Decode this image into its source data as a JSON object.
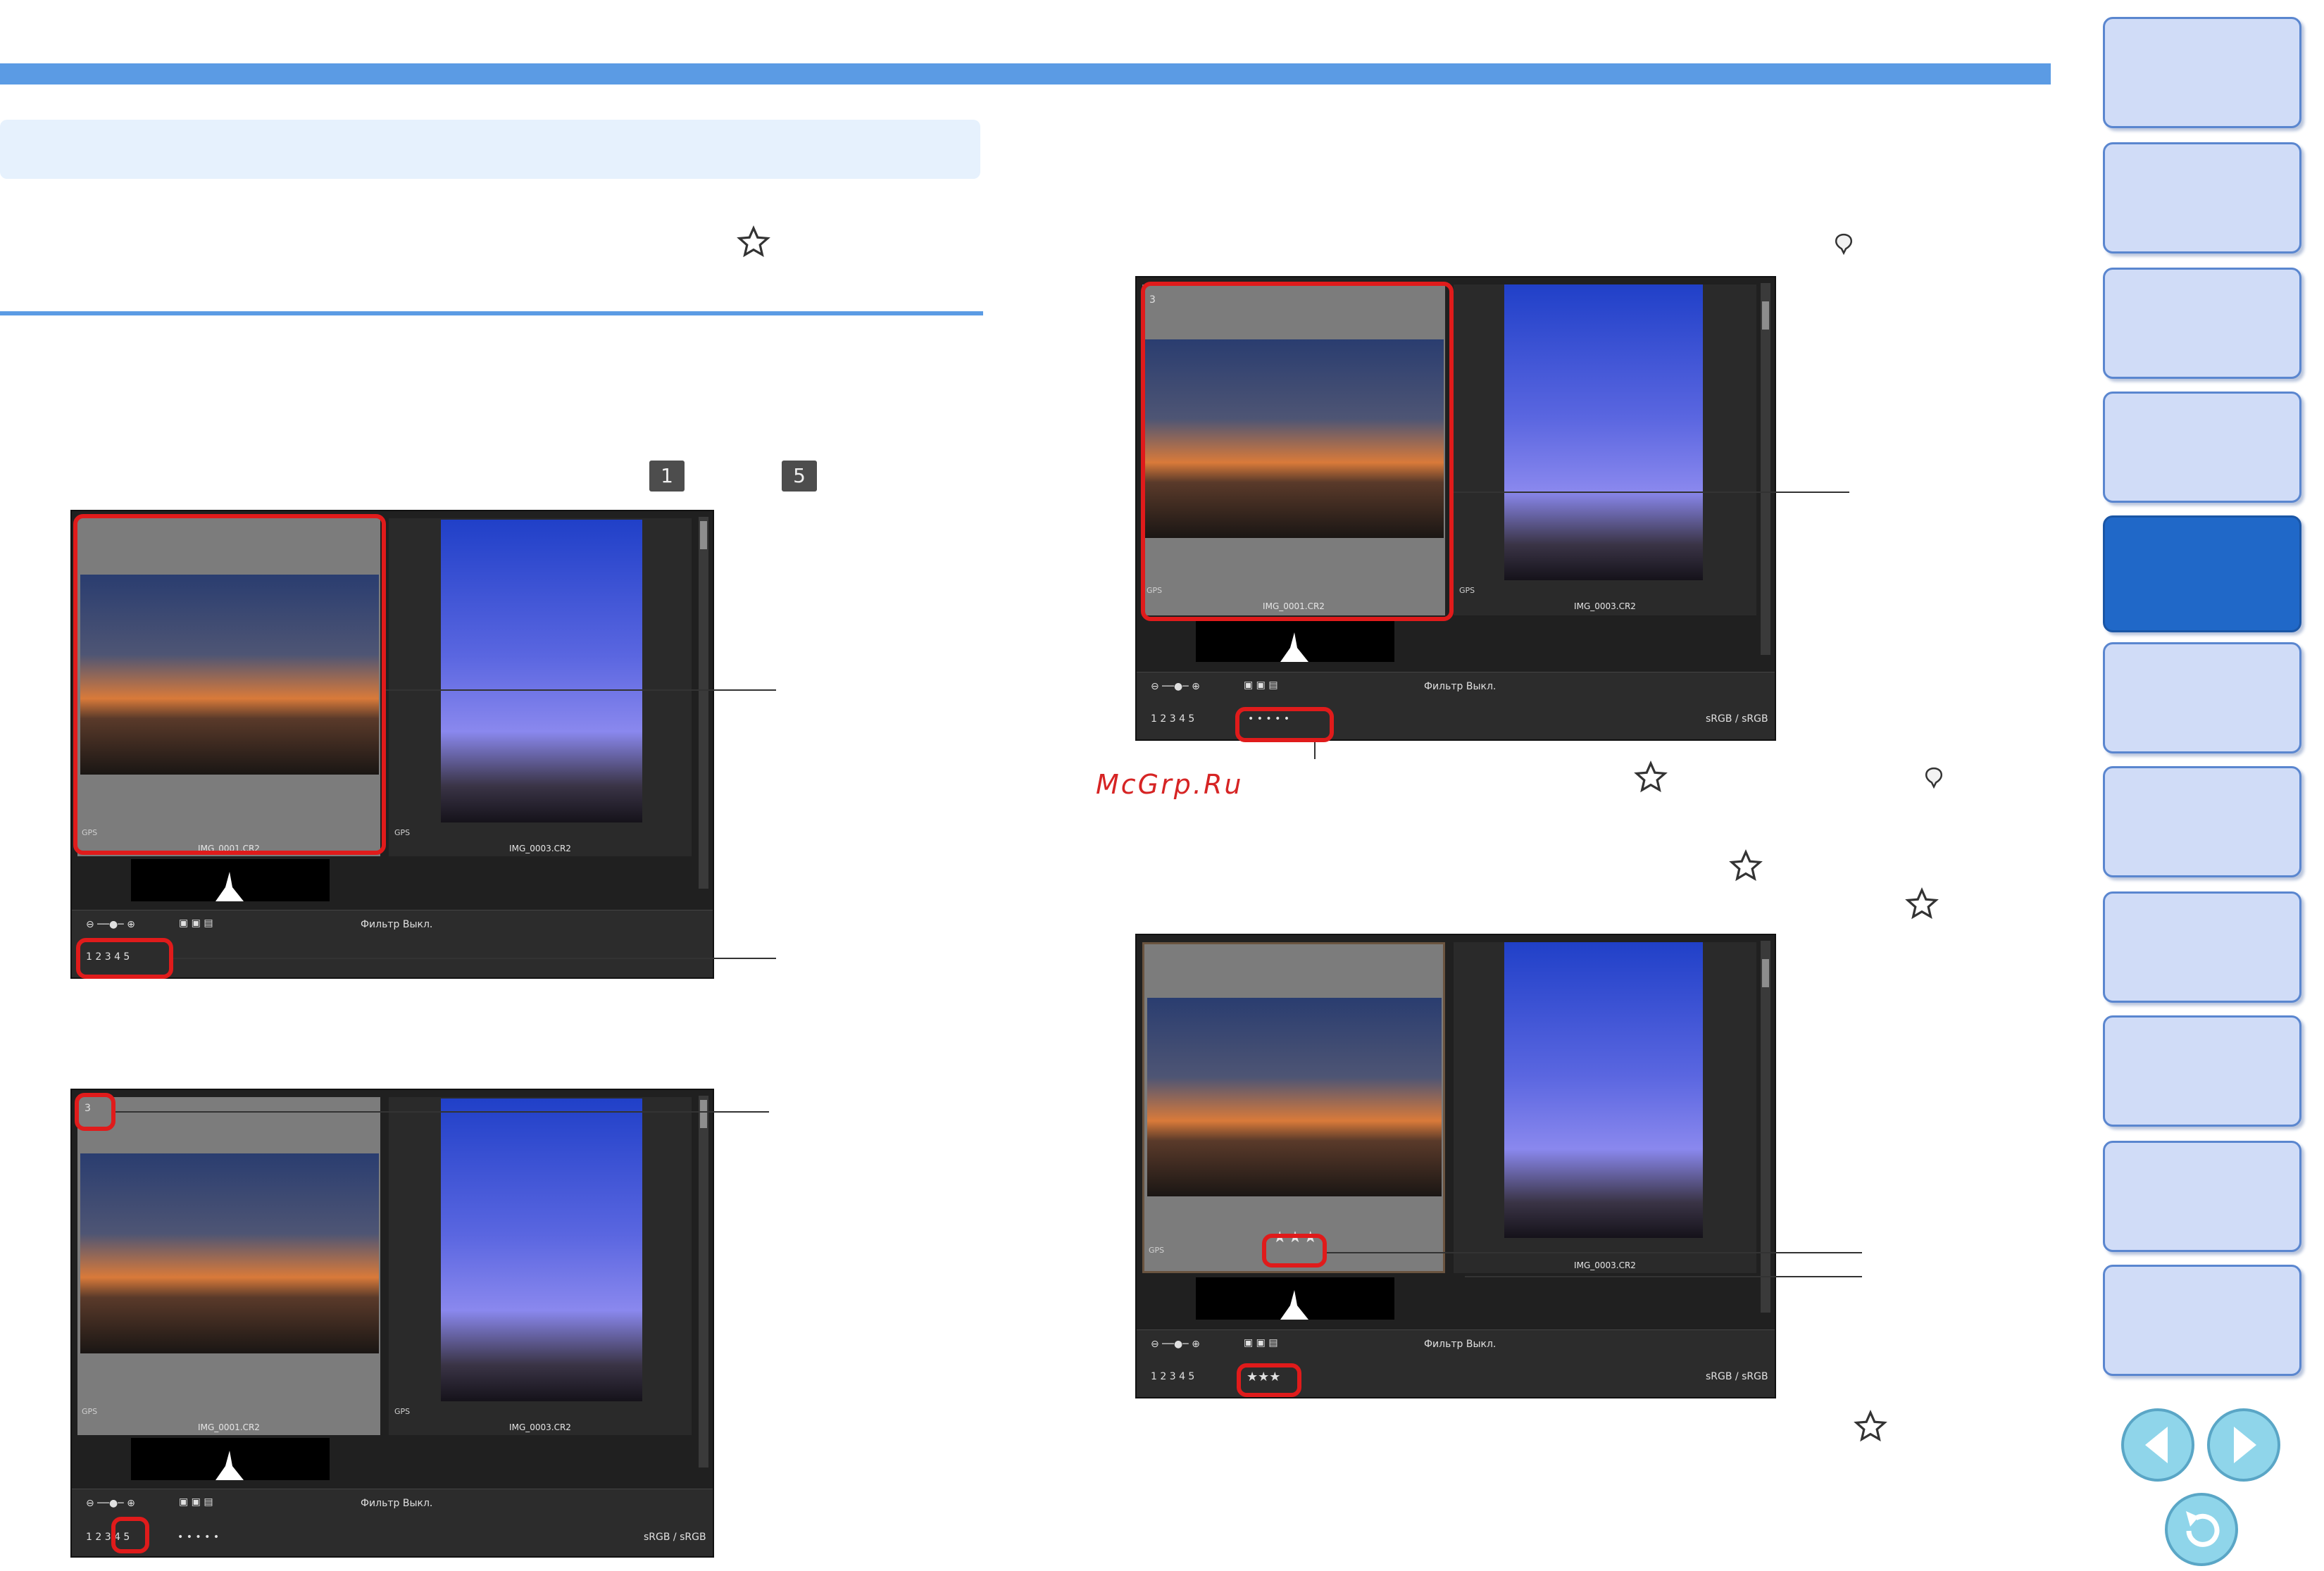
{
  "watermark": "McGrp.Ru",
  "label_icons": {
    "first": "1",
    "last": "5"
  },
  "shot1": {
    "file_a": "IMG_0001.CR2",
    "file_b": "IMG_0003.CR2",
    "gps": "GPS",
    "labels": "1 2 3 4 5",
    "filter_text": "Фильтр  Выкл."
  },
  "shot2": {
    "file_a": "IMG_0001.CR2",
    "file_b": "IMG_0003.CR2",
    "gps": "GPS",
    "badge": "3",
    "labels": "1 2 3 4 5",
    "filter_text": "Фильтр  Выкл.",
    "colorspace": "sRGB / sRGB"
  },
  "shot3": {
    "file_a": "IMG_0001.CR2",
    "file_b": "IMG_0003.CR2",
    "gps": "GPS",
    "badge": "3",
    "labels": "1 2 3 4 5",
    "filter_text": "Фильтр  Выкл.",
    "colorspace": "sRGB / sRGB"
  },
  "shot4": {
    "file_b": "IMG_0003.CR2",
    "gps": "GPS",
    "stars": "★★★",
    "labels": "1 2 3 4 5",
    "filter_text": "Фильтр  Выкл.",
    "colorspace": "sRGB / sRGB"
  },
  "nav": {
    "tab_count": 11,
    "active_index": 4
  },
  "colors": {
    "accent": "#5b9be4",
    "highlight": "#e01b1b",
    "active_tab": "#2068c8"
  }
}
